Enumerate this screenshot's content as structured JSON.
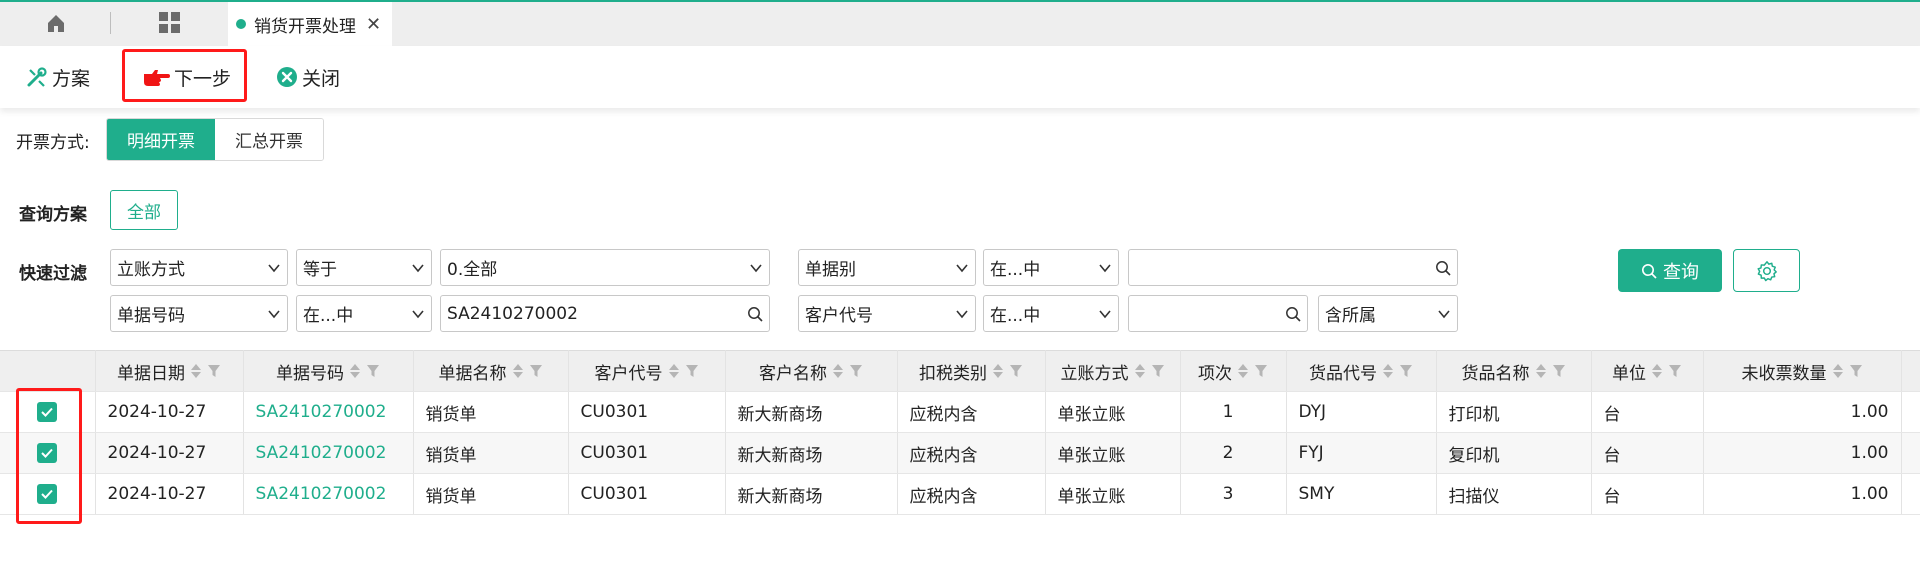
{
  "tabs": {
    "active_label": "销货开票处理",
    "close_glyph": "✕"
  },
  "toolbar": {
    "scheme_label": "方案",
    "next_label": "下一步",
    "close_label": "关闭"
  },
  "invoice_mode": {
    "label": "开票方式:",
    "options": [
      "明细开票",
      "汇总开票"
    ],
    "selected": "明细开票"
  },
  "query_scheme": {
    "label": "查询方案",
    "all_label": "全部"
  },
  "quick_filter": {
    "label": "快速过滤",
    "row1": {
      "field1": "立账方式",
      "op1": "等于",
      "value1": "0.全部",
      "field2": "单据别",
      "op2": "在...中",
      "value2": ""
    },
    "row2": {
      "field1": "单据号码",
      "op1": "在...中",
      "value1": "SA2410270002",
      "field2": "客户代号",
      "op2": "在...中",
      "value2": "",
      "extra": "含所属"
    },
    "query_label": "查询"
  },
  "table": {
    "columns": [
      "单据日期",
      "单据号码",
      "单据名称",
      "客户代号",
      "客户名称",
      "扣税类别",
      "立账方式",
      "项次",
      "货品代号",
      "货品名称",
      "单位",
      "未收票数量"
    ],
    "rows": [
      {
        "date": "2024-10-27",
        "doc_no": "SA2410270002",
        "doc_name": "销货单",
        "cust_code": "CU0301",
        "cust_name": "新大新商场",
        "tax_type": "应税内含",
        "acct_method": "单张立账",
        "item_no": "1",
        "goods_code": "DYJ",
        "goods_name": "打印机",
        "unit": "台",
        "qty": "1.00"
      },
      {
        "date": "2024-10-27",
        "doc_no": "SA2410270002",
        "doc_name": "销货单",
        "cust_code": "CU0301",
        "cust_name": "新大新商场",
        "tax_type": "应税内含",
        "acct_method": "单张立账",
        "item_no": "2",
        "goods_code": "FYJ",
        "goods_name": "复印机",
        "unit": "台",
        "qty": "1.00"
      },
      {
        "date": "2024-10-27",
        "doc_no": "SA2410270002",
        "doc_name": "销货单",
        "cust_code": "CU0301",
        "cust_name": "新大新商场",
        "tax_type": "应税内含",
        "acct_method": "单张立账",
        "item_no": "3",
        "goods_code": "SMY",
        "goods_name": "扫描仪",
        "unit": "台",
        "qty": "1.00"
      }
    ]
  },
  "colors": {
    "accent": "#1fae8c",
    "highlight": "#ff1a1a"
  }
}
